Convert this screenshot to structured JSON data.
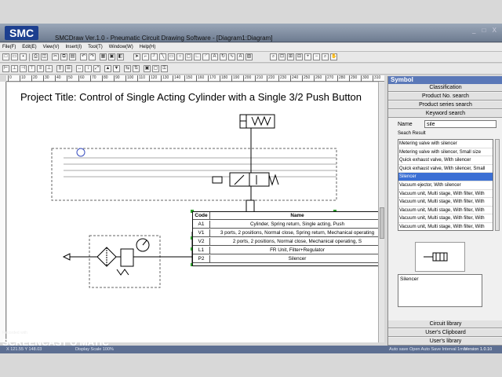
{
  "window": {
    "logo": "SMC",
    "title": "SMCDraw Ver.1.0 - Pneumatic Circuit Drawing Software - [Diagram1:Diagram]",
    "controls": "_ □ X"
  },
  "menu": [
    "File(F)",
    "Edit(E)",
    "View(V)",
    "Insert(I)",
    "Tool(T)",
    "Window(W)",
    "Help(H)"
  ],
  "ruler": {
    "ticks": [
      "0",
      "10",
      "20",
      "30",
      "40",
      "50",
      "60",
      "70",
      "80",
      "90",
      "100",
      "110",
      "120",
      "130",
      "140",
      "150",
      "160",
      "170",
      "180",
      "190",
      "200",
      "210",
      "220",
      "230",
      "240",
      "250",
      "260",
      "270",
      "280",
      "290",
      "300",
      "310"
    ]
  },
  "canvas": {
    "project_title": "Project Title: Control of Single Acting Cylinder with a Single 3/2 Push Button",
    "bom": {
      "headers": {
        "code": "Code",
        "name": "Name"
      },
      "rows": [
        {
          "code": "A1",
          "name": "Cylinder, Spring return, Single acting, Push"
        },
        {
          "code": "V1",
          "name": "3 ports, 2 positions, Normal close, Spring return, Mechanical operating"
        },
        {
          "code": "V2",
          "name": "2 ports, 2 positions, Normal close, Mechanical operating, S"
        },
        {
          "code": "L1",
          "name": "FR Unit, Filter+Regulator"
        },
        {
          "code": "P2",
          "name": "Silencer"
        }
      ]
    }
  },
  "panel": {
    "title": "Symbol",
    "tabs_top": [
      "Classification",
      "Product No. search",
      "Product series search",
      "Keyword search"
    ],
    "name_label": "Name",
    "name_value": "sile",
    "search_result_label": "Seach Result",
    "results": [
      "Metering valve with silencer",
      "Metering valve with silencer, Small size",
      "Quick exhaust valve, With silencer",
      "Quick exhaust valve, With silencer, Small",
      "Silencer",
      "Vacuum ejector, With silencer",
      "Vacuum unit, Multi stage, With filter, With",
      "Vacuum unit, Multi stage, With filter, With",
      "Vacuum unit, Multi stage, With filter, With",
      "Vacuum unit, Multi stage, With filter, With",
      "Vacuum unit, Multi stage, With filter, With"
    ],
    "selected_index": 4,
    "description": "Silencer",
    "tabs_bottom": [
      "Circuit library",
      "User's Clipboard",
      "User's library"
    ]
  },
  "status": {
    "coords": "X 121.55 Y 148.03",
    "scale": "Display Scale 100%",
    "autosave": "Auto save Open Auto Save Interval 1min",
    "version": "Version 1.0.10"
  },
  "watermark": {
    "top": "Recorded with",
    "brand": "SCREENCAST O MATIC"
  },
  "colors": {
    "titlebar": "#7f8ca0",
    "panel_header": "#5a78b8",
    "selection": "#3b6fd4",
    "status": "#5d6f92",
    "handles": "#2aa02a"
  }
}
